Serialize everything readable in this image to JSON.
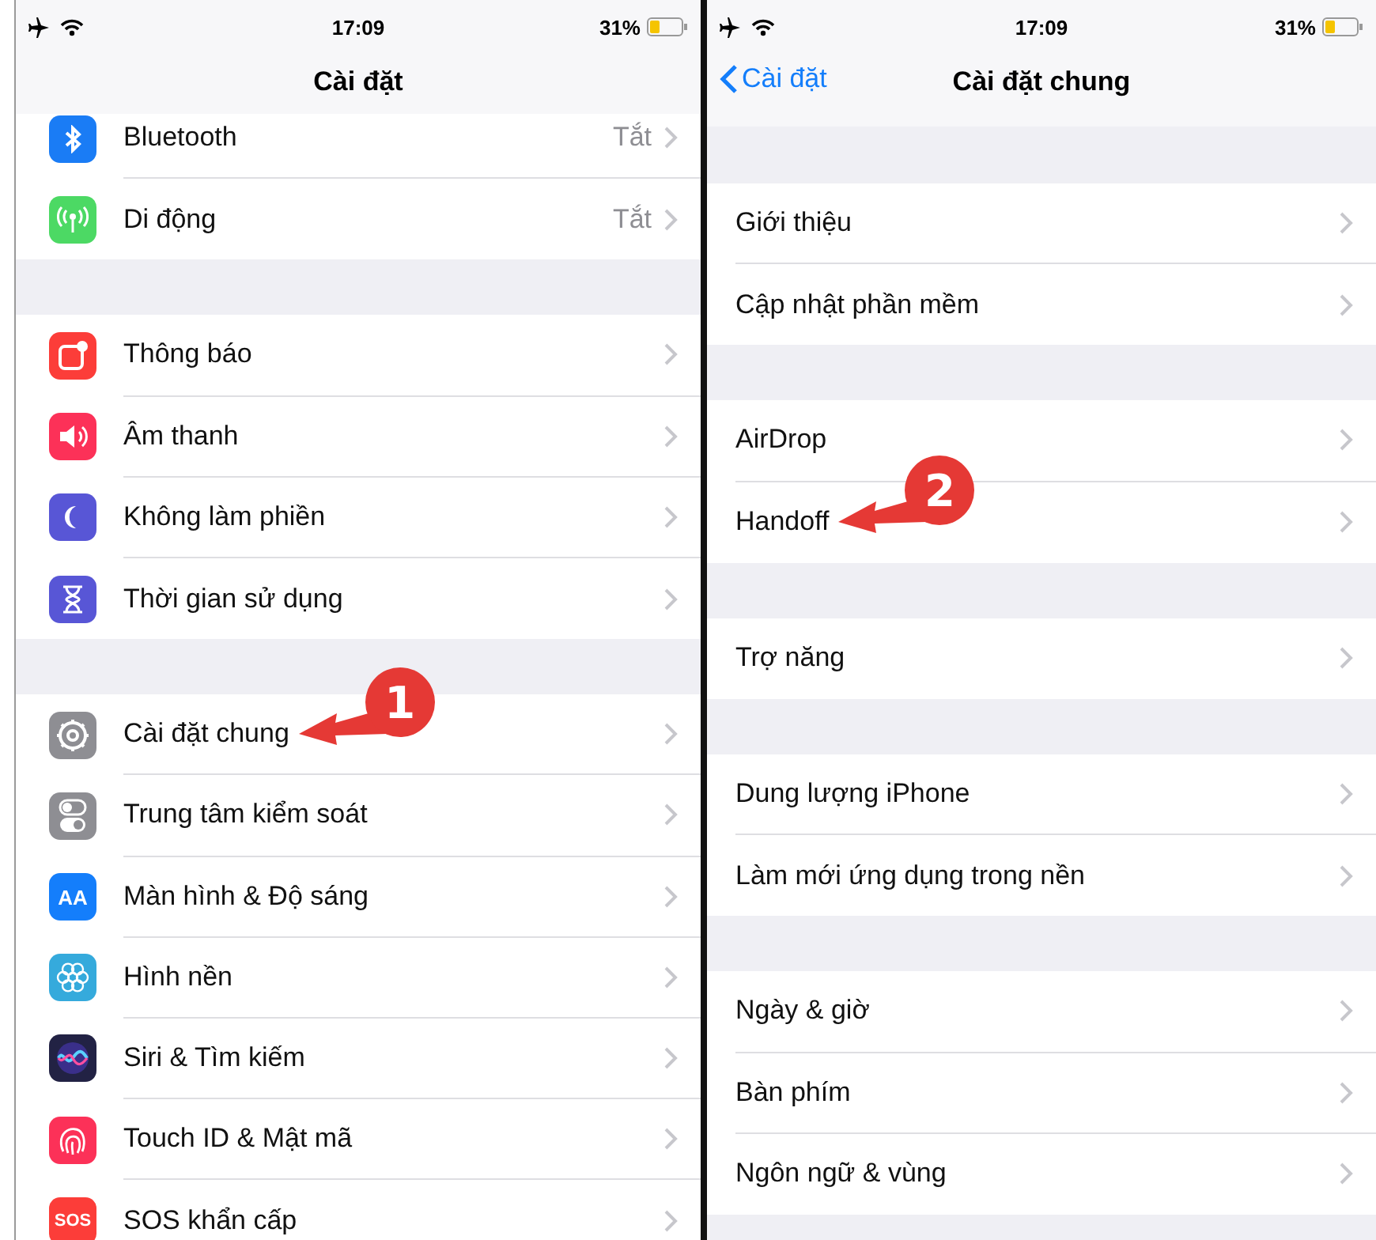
{
  "panels": [
    {
      "status_bar": {
        "time": "17:09",
        "battery": "31%"
      },
      "nav": {
        "title": "Cài đặt"
      },
      "groups": [
        [
          {
            "label": "Bluetooth",
            "value": "Tắt",
            "kind": "bluetooth",
            "color": "#1a7cf5"
          },
          {
            "label": "Di động",
            "value": "Tắt",
            "kind": "antenna",
            "color": "#4cd964"
          }
        ],
        [
          {
            "label": "Thông báo",
            "kind": "notification",
            "color": "#fc3d39"
          },
          {
            "label": "Âm thanh",
            "kind": "speaker",
            "color": "#fc3158"
          },
          {
            "label": "Không làm phiền",
            "kind": "moon",
            "color": "#5856d6"
          },
          {
            "label": "Thời gian sử dụng",
            "kind": "hourglass",
            "color": "#5856d6"
          }
        ],
        [
          {
            "label": "Cài đặt chung",
            "kind": "gear",
            "color": "#8e8e93",
            "callout": "1"
          },
          {
            "label": "Trung tâm kiểm soát",
            "kind": "toggles",
            "color": "#8e8e93"
          },
          {
            "label": "Màn hình & Độ sáng",
            "kind": "textsize",
            "color": "#147efb",
            "icon_text": "AA"
          },
          {
            "label": "Hình nền",
            "kind": "flower",
            "color": "#35aadc"
          },
          {
            "label": "Siri & Tìm kiếm",
            "kind": "siri",
            "color": "#222244"
          },
          {
            "label": "Touch ID & Mật mã",
            "kind": "fingerprint",
            "color": "#fc3158"
          },
          {
            "label": "SOS khẩn cấp",
            "kind": "sos",
            "color": "#fc3d39",
            "icon_text": "SOS"
          }
        ]
      ]
    },
    {
      "status_bar": {
        "time": "17:09",
        "battery": "31%"
      },
      "nav": {
        "back": "Cài đặt",
        "title": "Cài đặt chung"
      },
      "groups": [
        [
          {
            "label": "Giới thiệu"
          },
          {
            "label": "Cập nhật phần mềm"
          }
        ],
        [
          {
            "label": "AirDrop"
          },
          {
            "label": "Handoff",
            "callout": "2"
          }
        ],
        [
          {
            "label": "Trợ năng"
          }
        ],
        [
          {
            "label": "Dung lượng iPhone"
          },
          {
            "label": "Làm mới ứng dụng trong nền"
          }
        ],
        [
          {
            "label": "Ngày & giờ"
          },
          {
            "label": "Bàn phím"
          },
          {
            "label": "Ngôn ngữ & vùng"
          }
        ]
      ]
    }
  ]
}
